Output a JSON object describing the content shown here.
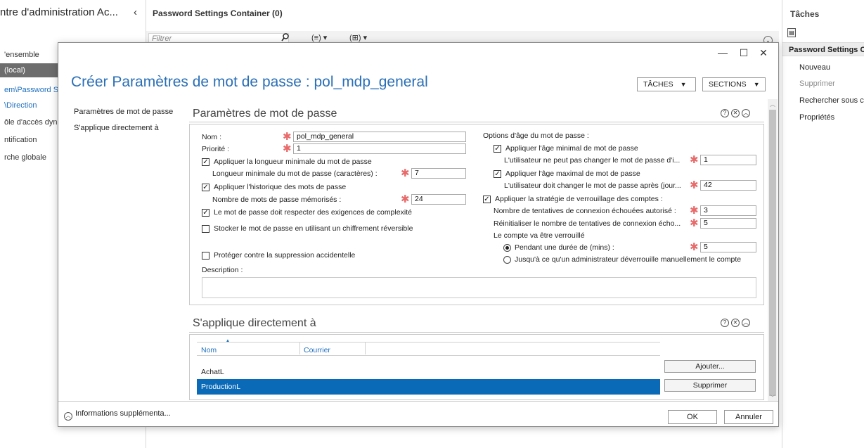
{
  "background_window": {
    "title": "ntre d'administration Ac...",
    "collapse_glyph": "‹",
    "container_title": "Password Settings Container  (0)",
    "filter_placeholder": "Filtrer",
    "filter_options": "(≡) ▾",
    "filter_options2": "(⊞) ▾",
    "nav_items": [
      {
        "label": "'ensemble"
      },
      {
        "label": "(local)"
      },
      {
        "label": "em\\Password S"
      },
      {
        "label": "\\Direction"
      },
      {
        "label": "ôle d'accès dyn"
      },
      {
        "label": "ntification"
      },
      {
        "label": "rche globale"
      }
    ]
  },
  "tasks_pane": {
    "title": "Tâches",
    "section": "Password Settings Co",
    "items": [
      {
        "label": "Nouveau",
        "enabled": true
      },
      {
        "label": "Supprimer",
        "enabled": false
      },
      {
        "label": "Rechercher sous c",
        "enabled": true
      },
      {
        "label": "Propriétés",
        "enabled": true
      }
    ]
  },
  "dialog": {
    "window_controls": {
      "minimize": "—",
      "maximize": "☐",
      "close": "✕"
    },
    "title": "Créer Paramètres de mot de passe : pol_mdp_general",
    "tasks_button": "TÂCHES",
    "sections_button": "SECTIONS",
    "left_nav": [
      "Paramètres de mot de passe",
      "S'applique directement à"
    ],
    "password_section": {
      "title": "Paramètres de mot de passe",
      "name_label": "Nom :",
      "name_value": "pol_mdp_general",
      "priority_label": "Priorité :",
      "priority_value": "1",
      "min_length_check": "Appliquer la longueur minimale du mot de passe",
      "min_length_label": "Longueur minimale du mot de passe (caractères) :",
      "min_length_value": "7",
      "history_check": "Appliquer l'historique des mots de passe",
      "history_label": "Nombre de mots de passe mémorisés :",
      "history_value": "24",
      "complexity_check": "Le mot de passe doit respecter des exigences de complexité",
      "reversible_check": "Stocker le mot de passe en utilisant un chiffrement réversible",
      "protect_check": "Protéger contre la suppression accidentelle",
      "description_label": "Description :",
      "age_options_label": "Options d'âge du mot de passe :",
      "min_age_check": "Appliquer l'âge minimal de mot de passe",
      "min_age_label": "L'utilisateur ne peut pas changer le mot de passe d'i...",
      "min_age_value": "1",
      "max_age_check": "Appliquer l'âge maximal de mot de passe",
      "max_age_label": "L'utilisateur doit changer le mot de passe après (jour...",
      "max_age_value": "42",
      "lockout_check": "Appliquer la stratégie de verrouillage des comptes :",
      "attempts_label": "Nombre de tentatives de connexion échouées autorisé :",
      "attempts_value": "3",
      "reset_label": "Réinitialiser le nombre de tentatives de connexion écho...",
      "reset_value": "5",
      "locked_label": "Le compte va être verrouillé",
      "duration_radio": "Pendant une durée de (mins) :",
      "duration_value": "5",
      "admin_radio": "Jusqu'à ce qu'un administrateur déverrouille manuellement le compte"
    },
    "applies_section": {
      "title": "S'applique directement à",
      "col_name": "Nom",
      "col_mail": "Courrier",
      "rows": [
        {
          "name": "AchatL",
          "selected": false
        },
        {
          "name": "ProductionL",
          "selected": true
        }
      ],
      "add_button": "Ajouter...",
      "remove_button": "Supprimer"
    },
    "more_info": "Informations supplémenta...",
    "ok_button": "OK",
    "cancel_button": "Annuler"
  },
  "colors": {
    "title_blue": "#2a6fb6",
    "selection_blue": "#0a6ab8",
    "required_star": "#e86a6a"
  },
  "icons": [
    "search-icon",
    "expand-icon",
    "help-icon",
    "close-section-icon",
    "collapse-section-icon",
    "sort-arrow-icon",
    "task-clipboard-icon"
  ]
}
